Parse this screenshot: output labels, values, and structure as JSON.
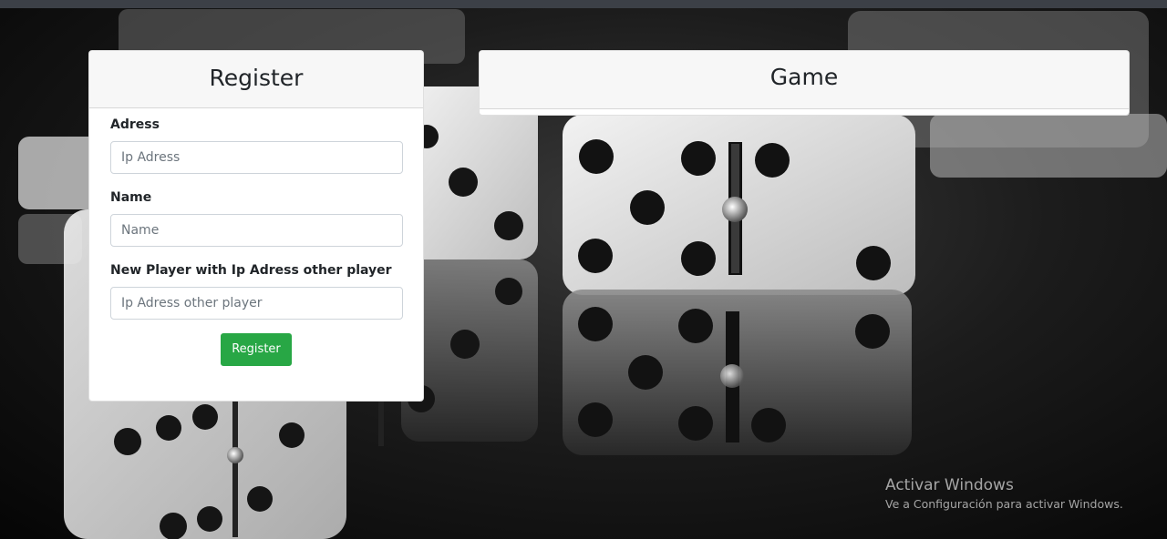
{
  "register_panel": {
    "title": "Register",
    "address_label": "Adress",
    "address_placeholder": "Ip Adress",
    "name_label": "Name",
    "name_placeholder": "Name",
    "other_player_label": "New Player with Ip Adress other player",
    "other_player_placeholder": "Ip Adress other player",
    "submit_label": "Register",
    "submit_color": "#28a745"
  },
  "game_panel": {
    "title": "Game"
  },
  "os_watermark": {
    "title": "Activar Windows",
    "subtitle": "Ve a Configuración para activar Windows."
  },
  "background": {
    "image_subject": "dominoes-on-reflective-black-surface"
  }
}
